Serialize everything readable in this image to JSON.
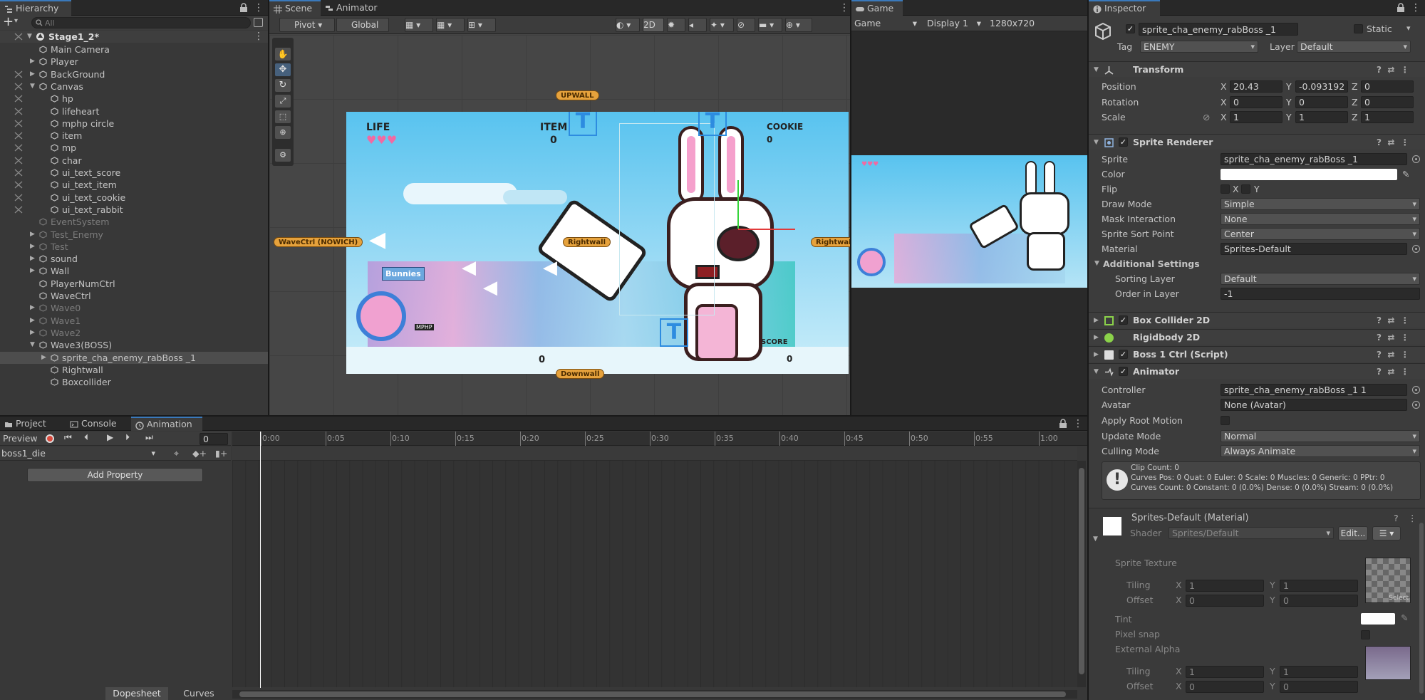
{
  "hierarchy": {
    "tab": "Hierarchy",
    "search_placeholder": "All",
    "scene": "Stage1_2*",
    "items": [
      {
        "label": "Main Camera",
        "indent": 1,
        "arrow": false,
        "dim": false,
        "vis": false
      },
      {
        "label": "Player",
        "indent": 1,
        "arrow": true,
        "dim": false,
        "vis": false
      },
      {
        "label": "BackGround",
        "indent": 1,
        "arrow": true,
        "dim": false,
        "vis": true
      },
      {
        "label": "Canvas",
        "indent": 1,
        "arrow": true,
        "open": true,
        "dim": false,
        "vis": true
      },
      {
        "label": "hp",
        "indent": 2,
        "arrow": false,
        "dim": false,
        "vis": true
      },
      {
        "label": "lifeheart",
        "indent": 2,
        "arrow": false,
        "dim": false,
        "vis": true
      },
      {
        "label": "mphp circle",
        "indent": 2,
        "arrow": false,
        "dim": false,
        "vis": true
      },
      {
        "label": "item",
        "indent": 2,
        "arrow": false,
        "dim": false,
        "vis": true
      },
      {
        "label": "mp",
        "indent": 2,
        "arrow": false,
        "dim": false,
        "vis": true
      },
      {
        "label": "char",
        "indent": 2,
        "arrow": false,
        "dim": false,
        "vis": true
      },
      {
        "label": "ui_text_score",
        "indent": 2,
        "arrow": false,
        "dim": false,
        "vis": true
      },
      {
        "label": "ui_text_item",
        "indent": 2,
        "arrow": false,
        "dim": false,
        "vis": true
      },
      {
        "label": "ui_text_cookie",
        "indent": 2,
        "arrow": false,
        "dim": false,
        "vis": true
      },
      {
        "label": "ui_text_rabbit",
        "indent": 2,
        "arrow": false,
        "dim": false,
        "vis": true
      },
      {
        "label": "EventSystem",
        "indent": 1,
        "arrow": false,
        "dim": true,
        "vis": false
      },
      {
        "label": "Test_Enemy",
        "indent": 1,
        "arrow": true,
        "dim": true,
        "vis": false
      },
      {
        "label": "Test",
        "indent": 1,
        "arrow": true,
        "dim": true,
        "vis": false
      },
      {
        "label": "sound",
        "indent": 1,
        "arrow": true,
        "dim": false,
        "vis": false
      },
      {
        "label": "Wall",
        "indent": 1,
        "arrow": true,
        "dim": false,
        "vis": false
      },
      {
        "label": "PlayerNumCtrl",
        "indent": 1,
        "arrow": false,
        "dim": false,
        "vis": false
      },
      {
        "label": "WaveCtrl",
        "indent": 1,
        "arrow": false,
        "dim": false,
        "vis": false
      },
      {
        "label": "Wave0",
        "indent": 1,
        "arrow": true,
        "dim": true,
        "vis": false
      },
      {
        "label": "Wave1",
        "indent": 1,
        "arrow": true,
        "dim": true,
        "vis": false
      },
      {
        "label": "Wave2",
        "indent": 1,
        "arrow": true,
        "dim": true,
        "vis": false
      },
      {
        "label": "Wave3(BOSS)",
        "indent": 1,
        "arrow": true,
        "open": true,
        "dim": false,
        "vis": false
      },
      {
        "label": "sprite_cha_enemy_rabBoss _1",
        "indent": 2,
        "arrow": true,
        "dim": false,
        "vis": false,
        "selected": true
      },
      {
        "label": "Rightwall",
        "indent": 2,
        "arrow": false,
        "dim": false,
        "vis": false
      },
      {
        "label": "Boxcollider",
        "indent": 2,
        "arrow": false,
        "dim": false,
        "vis": false
      }
    ]
  },
  "scene": {
    "tab_scene": "Scene",
    "tab_animator": "Animator",
    "pivot": "Pivot",
    "global": "Global",
    "mode2d": "2D",
    "labels": {
      "upwall": "UPWALL",
      "downwall": "Downwall",
      "rightwall": "Rightwall",
      "rightwall2": "Rightwall",
      "wavectrl": "WaveCtrl (NOWICH)",
      "life": "LIFE",
      "item": "ITEM",
      "cookie": "COOKIE",
      "item_count": "0",
      "cookie_count": "0",
      "rabbit_count": "0",
      "score_count": "0",
      "score": "SCORE",
      "bunnies": "Bunnies",
      "mphp": "MPHP"
    }
  },
  "game": {
    "tab": "Game",
    "display_mode": "Game",
    "display": "Display 1",
    "resolution": "1280x720"
  },
  "inspector": {
    "tab": "Inspector",
    "name": "sprite_cha_enemy_rabBoss _1",
    "static": "Static",
    "tag_label": "Tag",
    "tag": "ENEMY",
    "layer_label": "Layer",
    "layer": "Default",
    "transform": {
      "title": "Transform",
      "position": "Position",
      "rotation": "Rotation",
      "scale": "Scale",
      "pos": [
        "20.43",
        "-0.093192",
        "0"
      ],
      "rot": [
        "0",
        "0",
        "0"
      ],
      "scl": [
        "1",
        "1",
        "1"
      ]
    },
    "sprite_renderer": {
      "title": "Sprite Renderer",
      "sprite_k": "Sprite",
      "sprite": "sprite_cha_enemy_rabBoss _1",
      "color_k": "Color",
      "flip_k": "Flip",
      "flip_x": "X",
      "flip_y": "Y",
      "draw_k": "Draw Mode",
      "draw": "Simple",
      "mask_k": "Mask Interaction",
      "mask": "None",
      "sort_k": "Sprite Sort Point",
      "sort": "Center",
      "mat_k": "Material",
      "mat": "Sprites-Default",
      "add_k": "Additional Settings",
      "layer_k": "Sorting Layer",
      "layer": "Default",
      "order_k": "Order in Layer",
      "order": "-1"
    },
    "box_collider": "Box Collider 2D",
    "rigidbody": "Rigidbody 2D",
    "script": "Boss 1 Ctrl (Script)",
    "animator": {
      "title": "Animator",
      "ctrl_k": "Controller",
      "ctrl": "sprite_cha_enemy_rabBoss _1 1",
      "avatar_k": "Avatar",
      "avatar": "None (Avatar)",
      "root_k": "Apply Root Motion",
      "update_k": "Update Mode",
      "update": "Normal",
      "cull_k": "Culling Mode",
      "cull": "Always Animate",
      "info1": "Clip Count: 0",
      "info2": "Curves Pos: 0 Quat: 0 Euler: 0 Scale: 0 Muscles: 0 Generic: 0 PPtr: 0",
      "info3": "Curves Count: 0 Constant: 0 (0.0%) Dense: 0 (0.0%) Stream: 0 (0.0%)"
    },
    "material": {
      "title": "Sprites-Default (Material)",
      "shader_k": "Shader",
      "shader": "Sprites/Default",
      "edit": "Edit...",
      "tex_k": "Sprite Texture",
      "tiling_k": "Tiling",
      "offset_k": "Offset",
      "tint_k": "Tint",
      "pixel_k": "Pixel snap",
      "ext_k": "External Alpha",
      "select": "Select",
      "tiling": [
        "1",
        "1"
      ],
      "offset": [
        "0",
        "0"
      ],
      "tiling2": [
        "1",
        "1"
      ],
      "offset2": [
        "0",
        "0"
      ]
    }
  },
  "bottom": {
    "tab_project": "Project",
    "tab_console": "Console",
    "tab_animation": "Animation",
    "preview": "Preview",
    "frame": "0",
    "clip": "boss1_die",
    "add_property": "Add Property",
    "dopesheet": "Dopesheet",
    "curves": "Curves",
    "ticks": [
      "0:00",
      "0:05",
      "0:10",
      "0:15",
      "0:20",
      "0:25",
      "0:30",
      "0:35",
      "0:40",
      "0:45",
      "0:50",
      "0:55",
      "1:00"
    ]
  },
  "colors": {
    "accent": "#3a79bb",
    "selection": "#4d4d4d",
    "sky": "#62c4ee"
  }
}
